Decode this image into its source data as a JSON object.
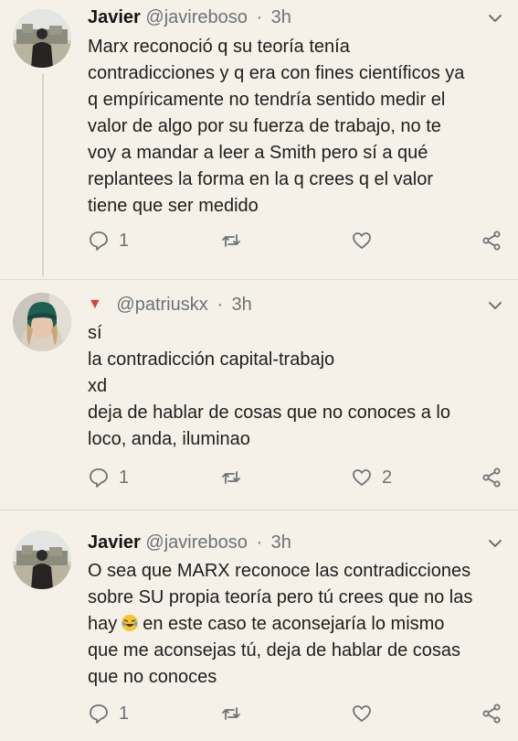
{
  "tweets": [
    {
      "name": "Javier",
      "handle": "@javireboso",
      "separator": "·",
      "time": "3h",
      "lines": [
        "Marx reconoció q su teoría tenía",
        "contradicciones y q era con fines científicos ya",
        "q empíricamente no tendría sentido medir el",
        "valor de algo por su fuerza de trabajo, no te",
        "voy a mandar a leer a Smith pero sí a qué",
        "replantees la forma en la q crees q el valor",
        "tiene que ser medido"
      ],
      "reply_count": "1",
      "retweet_count": "",
      "like_count": ""
    },
    {
      "name": "",
      "handle": "@patriuskx",
      "separator": "·",
      "time": "3h",
      "lines": [
        "sí",
        "la contradicción capital-trabajo",
        "xd",
        "deja de hablar de cosas que no conoces a lo",
        "loco, anda, iluminao"
      ],
      "reply_count": "1",
      "retweet_count": "",
      "like_count": "2"
    },
    {
      "name": "Javier",
      "handle": "@javireboso",
      "separator": "·",
      "time": "3h",
      "lines": [
        "O sea que MARX reconoce las contradicciones",
        "sobre SU propia teoría pero tú crees que no las",
        "hay",
        "que me aconsejas tú, deja de hablar de cosas",
        "que no conoces"
      ],
      "line3_after_emoji": "en este caso te aconsejaría lo mismo",
      "reply_count": "1",
      "retweet_count": "",
      "like_count": ""
    }
  ],
  "colors": {
    "background": "#f5f1e9",
    "icon_gray": "#6e7276",
    "flag_red": "#d8413c"
  },
  "icons": [
    "chevron-down-icon",
    "reply-icon",
    "retweet-icon",
    "like-icon",
    "share-icon",
    "flag-icon",
    "laughing-emoji-icon"
  ]
}
